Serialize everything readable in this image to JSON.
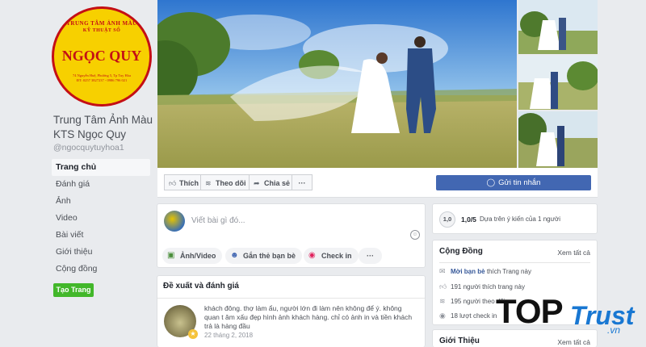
{
  "page": {
    "name": "Trung Tâm Ảnh Màu KTS Ngọc Quy",
    "handle": "@ngocquytuyhoa1",
    "logo": {
      "arc_top": "TRUNG TÂM ẢNH MÀU",
      "arc_sub": "KỸ THUẬT SỐ",
      "brand": "NGỌC QUY",
      "address": "74 Nguyễn Huệ, Phường 5, Tp Tuy Hòa",
      "phone": "ĐT: 0257 3827237 - 0986 796 021"
    }
  },
  "nav": {
    "items": [
      "Trang chủ",
      "Đánh giá",
      "Ảnh",
      "Video",
      "Bài viết",
      "Giới thiệu",
      "Cộng đồng"
    ],
    "active": "Trang chủ",
    "create_label": "Tạo Trang"
  },
  "actions": {
    "like": "Thích",
    "follow": "Theo dõi",
    "share": "Chia sẻ",
    "more": "···",
    "send_message": "Gửi tin nhắn"
  },
  "composer": {
    "placeholder": "Viết bài gì đó...",
    "chips": {
      "photo": "Ảnh/Video",
      "tag": "Gắn thẻ bạn bè",
      "checkin": "Check in",
      "more": "···"
    }
  },
  "reviews": {
    "title": "Đề xuất và đánh giá",
    "item": {
      "text": "khách đông. thợ làm ẩu, người lớn đi làm nên không để ý. không quan t âm xấu đẹp hình ảnh khách hàng. chỉ có ảnh in và tiền khách trả là hàng đầu",
      "date": "22 tháng 2, 2018"
    }
  },
  "rating": {
    "badge": "1,0",
    "score": "1,0/5",
    "description": "Dựa trên ý kiến của 1 người"
  },
  "community": {
    "title": "Cộng Đồng",
    "see_all": "Xem tất cả",
    "invite_link": "Mời bạn bè",
    "invite_text": "thích Trang này",
    "likes": "191 người thích trang này",
    "follows": "195 người theo dõi",
    "checkins": "18 lượt check in"
  },
  "intro": {
    "title": "Giới Thiệu",
    "see_all": "Xem tất cả"
  },
  "watermark": {
    "top": "TOP",
    "trust": "Trust",
    "domain": ".vn"
  },
  "colors": {
    "facebook_blue": "#4267b2",
    "create_green": "#42b72a",
    "logo_yellow": "#f7d000",
    "logo_red": "#c40f15",
    "watermark_blue": "#1877d2"
  }
}
